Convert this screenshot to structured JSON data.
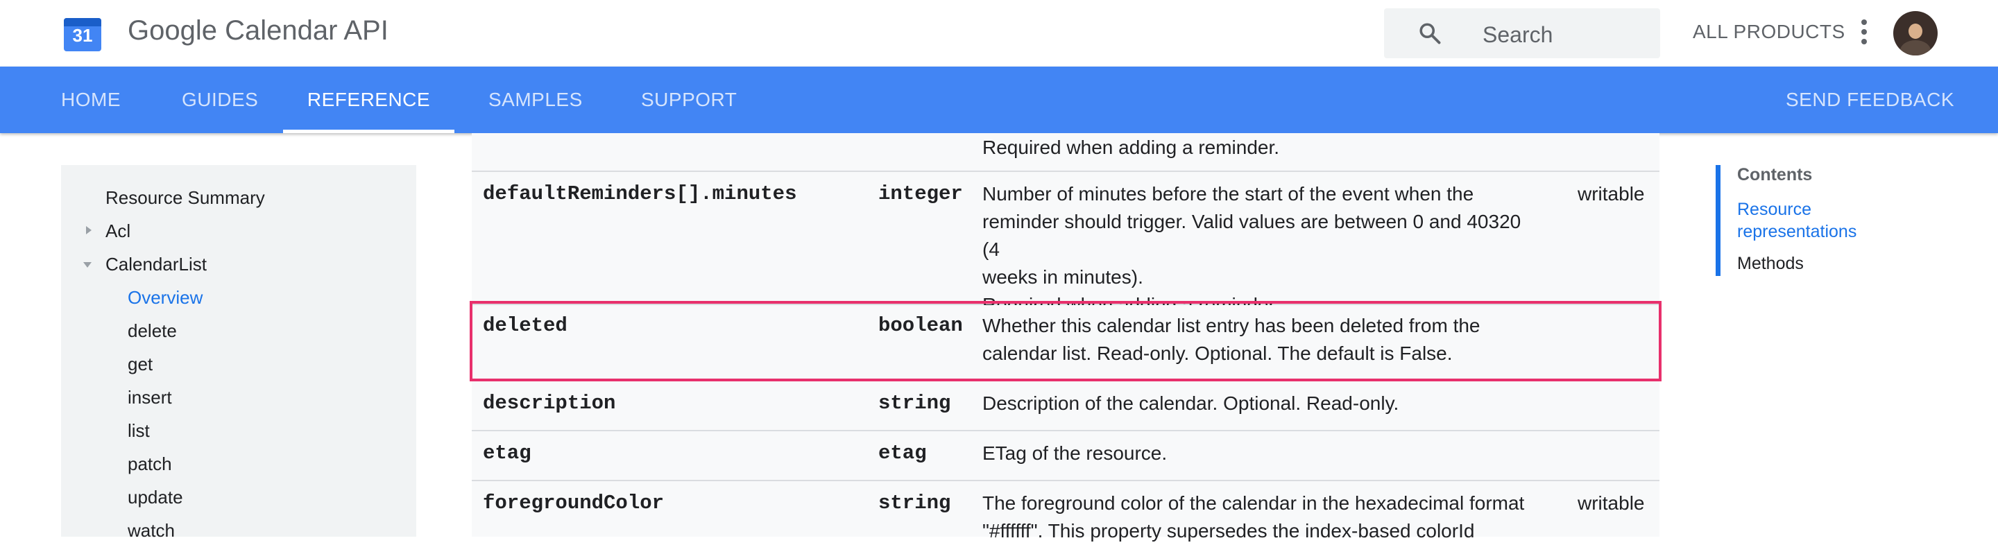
{
  "header": {
    "logo_number": "31",
    "title": "Google Calendar API",
    "search_placeholder": "Search",
    "all_products": "ALL PRODUCTS"
  },
  "nav": {
    "tabs": [
      {
        "label": "HOME"
      },
      {
        "label": "GUIDES"
      },
      {
        "label": "REFERENCE",
        "active": true
      },
      {
        "label": "SAMPLES"
      },
      {
        "label": "SUPPORT"
      }
    ],
    "send_feedback": "SEND FEEDBACK"
  },
  "sidebar": {
    "items": [
      {
        "label": "Resource Summary"
      },
      {
        "label": "Acl"
      },
      {
        "label": "CalendarList"
      },
      {
        "label": "Overview",
        "active": true
      },
      {
        "label": "delete"
      },
      {
        "label": "get"
      },
      {
        "label": "insert"
      },
      {
        "label": "list"
      },
      {
        "label": "patch"
      },
      {
        "label": "update"
      },
      {
        "label": "watch"
      }
    ]
  },
  "table": {
    "partial_top_text": "Required when adding a reminder.",
    "rows": [
      {
        "name": "defaultReminders[].minutes",
        "type": "integer",
        "desc_lines": [
          "Number of minutes before the start of the event when the",
          "reminder should trigger. Valid values are between 0 and 40320 (4",
          "weeks in minutes).",
          "Required when adding a reminder."
        ],
        "note": "writable"
      },
      {
        "name": "deleted",
        "type": "boolean",
        "desc_lines": [
          "Whether this calendar list entry has been deleted from the",
          "calendar list. Read-only. Optional. The default is False."
        ],
        "note": ""
      },
      {
        "name": "description",
        "type": "string",
        "desc_lines": [
          "Description of the calendar. Optional. Read-only."
        ],
        "note": ""
      },
      {
        "name": "etag",
        "type": "etag",
        "desc_lines": [
          "ETag of the resource."
        ],
        "note": ""
      },
      {
        "name": "foregroundColor",
        "type": "string",
        "desc_lines": [
          "The foreground color of the calendar in the hexadecimal format",
          "\"#ffffff\". This property supersedes the index-based colorId"
        ],
        "note": "writable"
      }
    ]
  },
  "toc": {
    "heading": "Contents",
    "link_lines": [
      "Resource",
      "representations"
    ],
    "methods": "Methods"
  },
  "colors": {
    "nav_bg": "#4285f4",
    "highlight_border": "#e8306c",
    "link": "#1a73e8"
  }
}
